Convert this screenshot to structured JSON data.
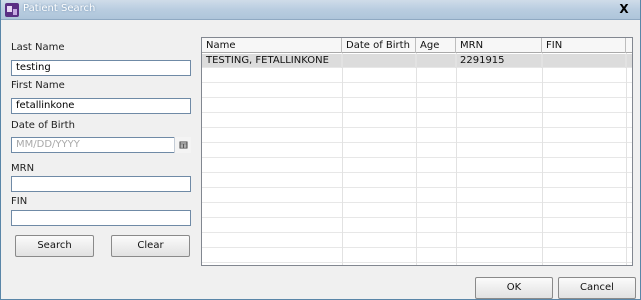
{
  "window": {
    "title": "Patient Search",
    "close_label": "X"
  },
  "form": {
    "last_name_label": "Last Name",
    "last_name_value": "testing",
    "first_name_label": "First Name",
    "first_name_value": "fetallinkone",
    "dob_label": "Date of Birth",
    "dob_placeholder": "MM/DD/YYYY",
    "mrn_label": "MRN",
    "mrn_value": "",
    "fin_label": "FIN",
    "fin_value": "",
    "search_label": "Search",
    "clear_label": "Clear"
  },
  "results": {
    "columns": [
      "Name",
      "Date of Birth",
      "Age",
      "MRN",
      "FIN"
    ],
    "rows": [
      {
        "name": "TESTING, FETALLINKONE",
        "dob": "",
        "age": "",
        "mrn": "2291915",
        "fin": ""
      }
    ]
  },
  "footer": {
    "ok_label": "OK",
    "cancel_label": "Cancel"
  },
  "colors": {
    "titlebar": "#b9cde0",
    "selected_row": "#dcdcdc",
    "grid_border": "#828790"
  },
  "icons": {
    "app_icon": "patient-search-app-icon",
    "calendar_icon": "calendar-icon"
  }
}
